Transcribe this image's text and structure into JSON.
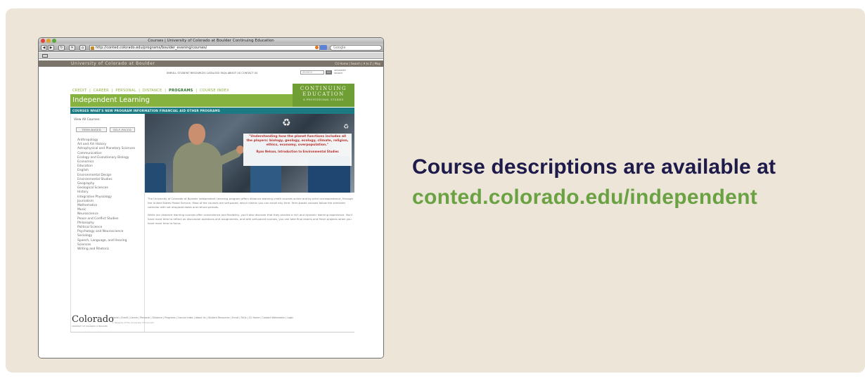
{
  "caption": {
    "line1": "Course descriptions are available at",
    "line2": "conted.colorado.edu/independent"
  },
  "browser": {
    "window_title": "Courses | University of Colorado at Boulder Continuing Education",
    "url": "http://conted.colorado.edu/programs/boulder_evening/courses/",
    "search_placeholder": "Google",
    "nav_icons": [
      "back-icon",
      "forward-icon",
      "reload-icon",
      "home-icon"
    ]
  },
  "site": {
    "cu_header": "University of Colorado at Boulder",
    "cu_links": "CU Home | Search | A to Z | Map",
    "utility_links": "ENROLL   STUDENT RESOURCES   CATALOGS   FAQs   ABOUT US   CONTACT US",
    "search_placeholder": "SEARCH",
    "go_label": "GO",
    "advanced_search": "ADVANCED SEARCH",
    "top_nav": [
      "CREDIT",
      "CAREER",
      "PERSONAL",
      "DISTANCE",
      "PROGRAMS",
      "COURSE INDEX"
    ],
    "top_nav_active": "PROGRAMS",
    "brand_line1": "CONTINUING",
    "brand_line2": "EDUCATION",
    "brand_line3": "& PROFESSIONAL STUDIES",
    "section_title": "Independent Learning",
    "sub_nav": "COURSES    WHAT'S NEW    PROGRAM INFORMATION    FINANCIAL AID    OTHER PROGRAMS",
    "view_all": "View All Courses:",
    "tabs": [
      "TERM-BASED",
      "SELF-PACED"
    ],
    "subjects": [
      "Anthropology",
      "Art and Art History",
      "Astrophysical and Planetary Sciences",
      "Communication",
      "Ecology and Evolutionary Biology",
      "Economics",
      "Education",
      "English",
      "Environmental Design",
      "Environmental Studies",
      "Geography",
      "Geological Sciences",
      "History",
      "Integrative Physiology",
      "Journalism",
      "Mathematics",
      "Music",
      "Neuroscience",
      "Peace and Conflict Studies",
      "Philosophy",
      "Political Science",
      "Psychology and Neuroscience",
      "Sociology",
      "Speech, Language, and Hearing",
      "Sciences",
      "Writing and Rhetoric"
    ],
    "quote": "\"Understanding how the planet functions includes all the players: biology, geology, ecology, climate, religion, ethics, economy, overpopulation.\"",
    "quote_attribution": "Ryan Nelson, Introduction to Environmental Studies",
    "body_p1": "The University of Colorado at Boulder Independent Learning program offers distance-learning credit courses online and by print correspondence, through the United States Postal Service. Most of the courses are self-paced, which means you can enroll any time. Term-based courses follow the semester calendar with set drop/add dates and refund periods.",
    "body_p2": "While our distance learning courses offer convenience and flexibility, you'll also discover that they provide a rich and dynamic learning experience. You'll have more time to reflect on discussion questions and assignments, and with self-paced courses, you can take final exams and finish projects when you have more time to focus.",
    "footer_logo": "Colorado",
    "footer_logo_sub": "UNIVERSITY OF COLORADO AT BOULDER",
    "footer_links": "Home | Credit | Career | Personal | Distance | Programs | Course Index | About Us | Student Resources | Enroll | FAQs | CU Home | Contact Webmaster | Login",
    "footer_copy": "© Regents of the University of Colorado"
  },
  "colors": {
    "panel_bg": "#ece5d8",
    "headline": "#1e1a4a",
    "url_green": "#6aa243",
    "teal_nav": "#1c7a82",
    "banner_green": "#86b33f"
  }
}
